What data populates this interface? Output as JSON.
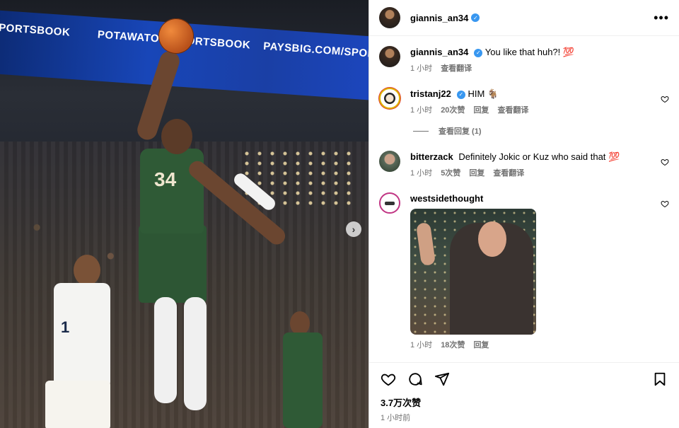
{
  "photo": {
    "banner_texts": [
      "PORTSBOOK",
      "POTAWATOMI",
      "SPORTSBOOK",
      "PAYSBIG.COM/SPORTSB"
    ],
    "player_number": "34",
    "defender_number": "1"
  },
  "header": {
    "username": "giannis_an34",
    "verified": true,
    "more_label": "•••"
  },
  "caption": {
    "username": "giannis_an34",
    "text": "You like that huh?! 💯",
    "time": "1 小时",
    "translate": "查看翻译"
  },
  "comments": [
    {
      "username": "tristanj22",
      "verified": true,
      "text": "HIM 🐐",
      "time": "1 小时",
      "likes": "20次赞",
      "reply": "回复",
      "translate": "查看翻译",
      "view_replies": "查看回复 (1)"
    },
    {
      "username": "bitterzack",
      "text": "Definitely Jokic or Kuz who said that 💯",
      "time": "1 小时",
      "likes": "5次赞",
      "reply": "回复",
      "translate": "查看翻译"
    },
    {
      "username": "westsidethought",
      "text": "",
      "time": "1 小时",
      "likes": "18次赞",
      "reply": "回复"
    }
  ],
  "footer": {
    "likes": "3.7万次赞",
    "posted": "1 小时前"
  },
  "colors": {
    "verified": "#3897f0",
    "meta_gray": "#737373",
    "border": "#dbdbdb"
  }
}
